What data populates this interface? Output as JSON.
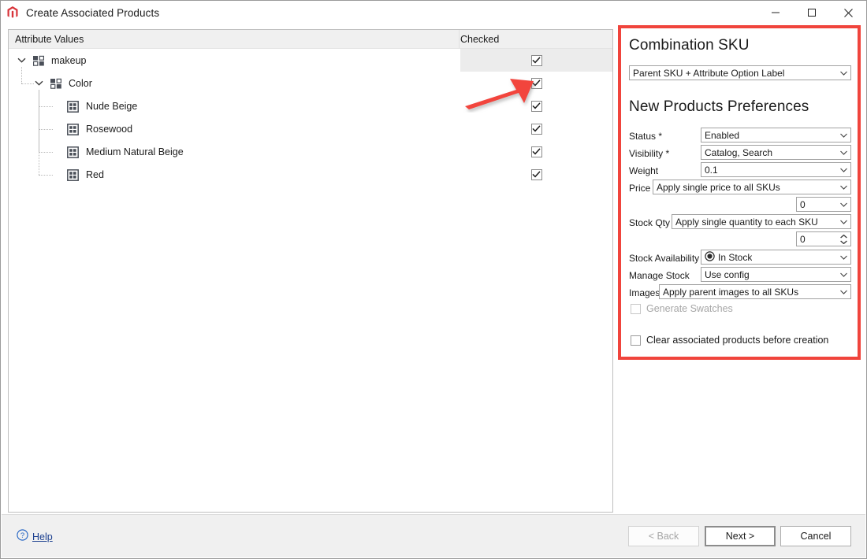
{
  "window": {
    "title": "Create Associated Products",
    "app_icon": "magento-logo-icon",
    "minimize_label": "minimize-icon",
    "maximize_label": "maximize-icon",
    "close_label": "close-icon",
    "accent_red": "#f0443c"
  },
  "tree": {
    "columns": {
      "attribute_values": "Attribute Values",
      "checked": "Checked"
    },
    "rows": [
      {
        "label": "makeup",
        "depth": 0,
        "icon": "attribute-set-icon",
        "expandable": true,
        "expanded": true,
        "checked": true,
        "selected": true
      },
      {
        "label": "Color",
        "depth": 1,
        "icon": "attribute-set-icon",
        "expandable": true,
        "expanded": true,
        "checked": true,
        "selected": false
      },
      {
        "label": "Nude Beige",
        "depth": 2,
        "icon": "attribute-option-icon",
        "expandable": false,
        "expanded": false,
        "checked": true,
        "selected": false
      },
      {
        "label": "Rosewood",
        "depth": 2,
        "icon": "attribute-option-icon",
        "expandable": false,
        "expanded": false,
        "checked": true,
        "selected": false
      },
      {
        "label": "Medium Natural Beige",
        "depth": 2,
        "icon": "attribute-option-icon",
        "expandable": false,
        "expanded": false,
        "checked": true,
        "selected": false
      },
      {
        "label": "Red",
        "depth": 2,
        "icon": "attribute-option-icon",
        "expandable": false,
        "expanded": false,
        "checked": true,
        "selected": false
      }
    ]
  },
  "annotation": {
    "arrow_color": "#f0443c",
    "points_to": "checked-checkbox-row-color"
  },
  "panel": {
    "combination_sku": {
      "heading": "Combination SKU",
      "value": "Parent SKU + Attribute Option Label"
    },
    "preferences": {
      "heading": "New Products Preferences",
      "fields": [
        {
          "label": "Status *",
          "value": "Enabled",
          "control": "dropdown"
        },
        {
          "label": "Visibility *",
          "value": "Catalog, Search",
          "control": "dropdown"
        },
        {
          "label": "Weight",
          "value": "0.1",
          "control": "dropdown"
        },
        {
          "label": "Price",
          "value": "Apply single price to all SKUs",
          "control": "dropdown"
        },
        {
          "label": "",
          "value": "0",
          "control": "dropdown"
        },
        {
          "label": "Stock Qty",
          "value": "Apply single quantity to each SKU",
          "control": "dropdown"
        },
        {
          "label": "",
          "value": "0",
          "control": "spinner"
        },
        {
          "label": "Stock Availability",
          "value": "In Stock",
          "control": "dropdown",
          "icon": "in-stock-icon"
        },
        {
          "label": "Manage Stock",
          "value": "Use config",
          "control": "dropdown"
        },
        {
          "label": "Images",
          "value": "Apply parent images to all SKUs",
          "control": "dropdown"
        }
      ],
      "checkboxes": [
        {
          "label": "Generate Swatches",
          "checked": false,
          "disabled": true
        },
        {
          "label": "Clear associated products before creation",
          "checked": false,
          "disabled": false
        }
      ]
    }
  },
  "footer": {
    "help_label": "Help",
    "help_icon": "help-question-icon",
    "back_label": "< Back",
    "back_disabled": true,
    "next_label": "Next >",
    "next_default": true,
    "cancel_label": "Cancel"
  }
}
